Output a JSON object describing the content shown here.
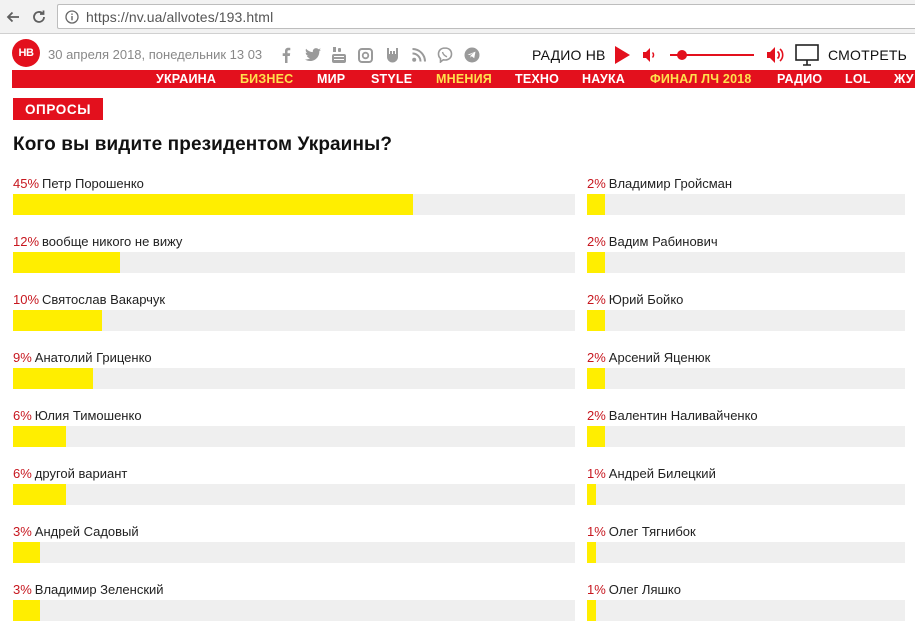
{
  "browser": {
    "url": "https://nv.ua/allvotes/193.html"
  },
  "header": {
    "logo_text": "НВ",
    "date": "30 апреля 2018, понедельник 13 03",
    "radio_label": "РАДИО НВ",
    "volume_level": 0.1,
    "watch_label": "СМОТРЕТЬ",
    "social_icons": [
      "facebook-icon",
      "twitter-icon",
      "youtube-icon",
      "instagram-icon",
      "rock-hand-icon",
      "rss-icon",
      "viber-icon",
      "telegram-icon"
    ]
  },
  "menu": [
    {
      "label": "УКРАИНА",
      "highlight": false
    },
    {
      "label": "БИЗНЕС",
      "highlight": true
    },
    {
      "label": "МИР",
      "highlight": false
    },
    {
      "label": "STYLE",
      "highlight": false
    },
    {
      "label": "МНЕНИЯ",
      "highlight": true
    },
    {
      "label": "ТЕХНО",
      "highlight": false
    },
    {
      "label": "НАУКА",
      "highlight": false
    },
    {
      "label": "ФИНАЛ ЛЧ 2018",
      "highlight": true
    },
    {
      "label": "РАДИО",
      "highlight": false
    },
    {
      "label": "LOL",
      "highlight": false
    },
    {
      "label": "ЖУ",
      "highlight": false
    }
  ],
  "section_badge": "ОПРОСЫ",
  "poll": {
    "title": "Кого вы видите президентом Украины?",
    "left": [
      {
        "pct": "45%",
        "name": "Петр Порошенко",
        "value": 45
      },
      {
        "pct": "12%",
        "name": "вообще никого не вижу",
        "value": 12
      },
      {
        "pct": "10%",
        "name": "Святослав Вакарчук",
        "value": 10
      },
      {
        "pct": "9%",
        "name": "Анатолий Гриценко",
        "value": 9
      },
      {
        "pct": "6%",
        "name": "Юлия Тимошенко",
        "value": 6
      },
      {
        "pct": "6%",
        "name": "другой вариант",
        "value": 6
      },
      {
        "pct": "3%",
        "name": "Андрей Садовый",
        "value": 3
      },
      {
        "pct": "3%",
        "name": "Владимир Зеленский",
        "value": 3
      }
    ],
    "right": [
      {
        "pct": "2%",
        "name": "Владимир Гройсман",
        "value": 2
      },
      {
        "pct": "2%",
        "name": "Вадим Рабинович",
        "value": 2
      },
      {
        "pct": "2%",
        "name": "Юрий Бойко",
        "value": 2
      },
      {
        "pct": "2%",
        "name": "Арсений Яценюк",
        "value": 2
      },
      {
        "pct": "2%",
        "name": "Валентин Наливайченко",
        "value": 2
      },
      {
        "pct": "1%",
        "name": "Андрей Билецкий",
        "value": 1
      },
      {
        "pct": "1%",
        "name": "Олег Тягнибок",
        "value": 1
      },
      {
        "pct": "1%",
        "name": "Олег Ляшко",
        "value": 1
      }
    ]
  },
  "colors": {
    "brand_red": "#e3101d",
    "bar_fill": "#ffee00",
    "bar_track": "#efefef",
    "pct_text": "#c7171f",
    "menu_highlight": "#ffe14d"
  }
}
